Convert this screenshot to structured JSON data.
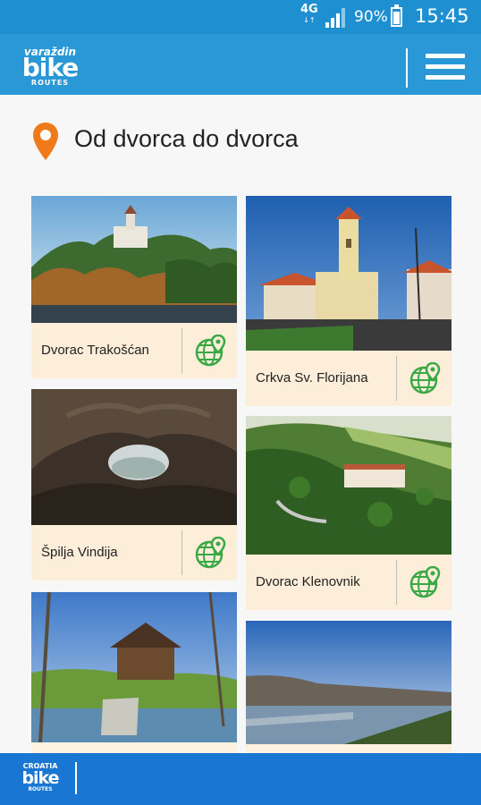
{
  "status_bar": {
    "network": "4G",
    "network_sub": "↓↑",
    "battery": "90%",
    "time": "15:45"
  },
  "app_bar": {
    "logo_top": "varaždin",
    "logo_main": "bike",
    "logo_bottom": "ROUTES"
  },
  "page": {
    "title": "Od dvorca do dvorca"
  },
  "cards": [
    {
      "name": "Dvorac Trakošćan",
      "icon": "globe-pin-icon"
    },
    {
      "name": "Crkva Sv. Florijana",
      "icon": "globe-pin-icon"
    },
    {
      "name": "Špilja Vindija",
      "icon": "globe-pin-icon"
    },
    {
      "name": "Dvorac Klenovnik",
      "icon": "globe-pin-icon"
    },
    {
      "name": "",
      "icon": ""
    },
    {
      "name": "",
      "icon": ""
    }
  ],
  "bottom_bar": {
    "logo_top": "CROATIA",
    "logo_main": "bike",
    "logo_bottom": "ROUTES"
  },
  "colors": {
    "status_bar": "#1e8fd0",
    "app_bar": "#2a98d6",
    "bottom_bar": "#1976d2",
    "caption_bg": "#fdeed9",
    "accent_green": "#3aa845",
    "pin_orange": "#f07a1a"
  }
}
